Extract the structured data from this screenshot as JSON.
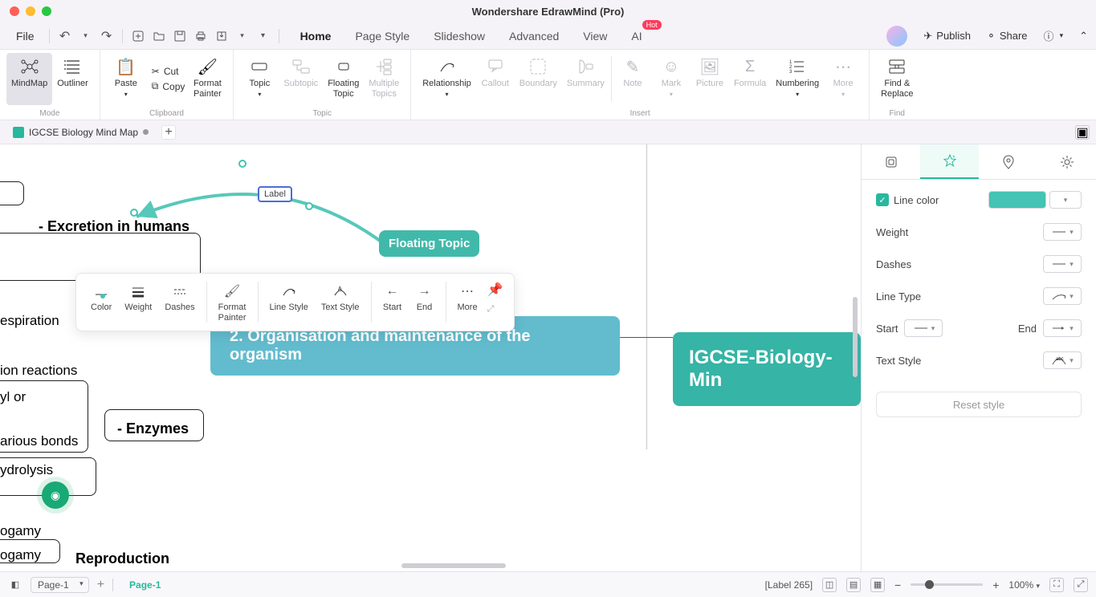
{
  "window": {
    "title": "Wondershare EdrawMind (Pro)"
  },
  "menubar": {
    "file": "File",
    "tabs": [
      "Home",
      "Page Style",
      "Slideshow",
      "Advanced",
      "View",
      "AI"
    ],
    "active_tab": "Home",
    "ai_badge": "Hot",
    "publish": "Publish",
    "share": "Share"
  },
  "ribbon": {
    "mode_label": "Mode",
    "clipboard_label": "Clipboard",
    "topic_label": "Topic",
    "insert_label": "Insert",
    "find_label": "Find",
    "mindmap": "MindMap",
    "outliner": "Outliner",
    "paste": "Paste",
    "cut": "Cut",
    "copy": "Copy",
    "format_painter": "Format\nPainter",
    "topic": "Topic",
    "subtopic": "Subtopic",
    "floating_topic": "Floating\nTopic",
    "multiple_topics": "Multiple\nTopics",
    "relationship": "Relationship",
    "callout": "Callout",
    "boundary": "Boundary",
    "summary": "Summary",
    "note": "Note",
    "mark": "Mark",
    "picture": "Picture",
    "formula": "Formula",
    "numbering": "Numbering",
    "more": "More",
    "find_replace": "Find &\nReplace"
  },
  "doc_tabs": {
    "tab1": "IGCSE Biology  Mind Map"
  },
  "canvas": {
    "label_text": "Label",
    "floating_topic": "Floating Topic",
    "excretion": "- Excretion in humans",
    "enzymes": "- Enzymes",
    "respiration": "espiration",
    "ion_reactions": "ion reactions",
    "yl_or": "yl or",
    "arious_bonds": "arious bonds",
    "ydrolysis": "ydrolysis",
    "ogamy1": "ogamy",
    "ogamy2": "ogamy",
    "reproduction": "Reproduction",
    "big_topic": "2. Organisation and maintenance of the organism",
    "root": "IGCSE-Biology-Min"
  },
  "floating_toolbar": {
    "color": "Color",
    "weight": "Weight",
    "dashes": "Dashes",
    "format_painter": "Format\nPainter",
    "line_style": "Line Style",
    "text_style": "Text Style",
    "start": "Start",
    "end": "End",
    "more": "More"
  },
  "rightpanel": {
    "line_color": "Line color",
    "weight": "Weight",
    "dashes": "Dashes",
    "line_type": "Line Type",
    "start": "Start",
    "end": "End",
    "text_style": "Text Style",
    "reset": "Reset style",
    "swatch_color": "#45c3b3"
  },
  "statusbar": {
    "page": "Page-1",
    "page_active": "Page-1",
    "label_count": "[Label 265]",
    "zoom": "100%"
  }
}
